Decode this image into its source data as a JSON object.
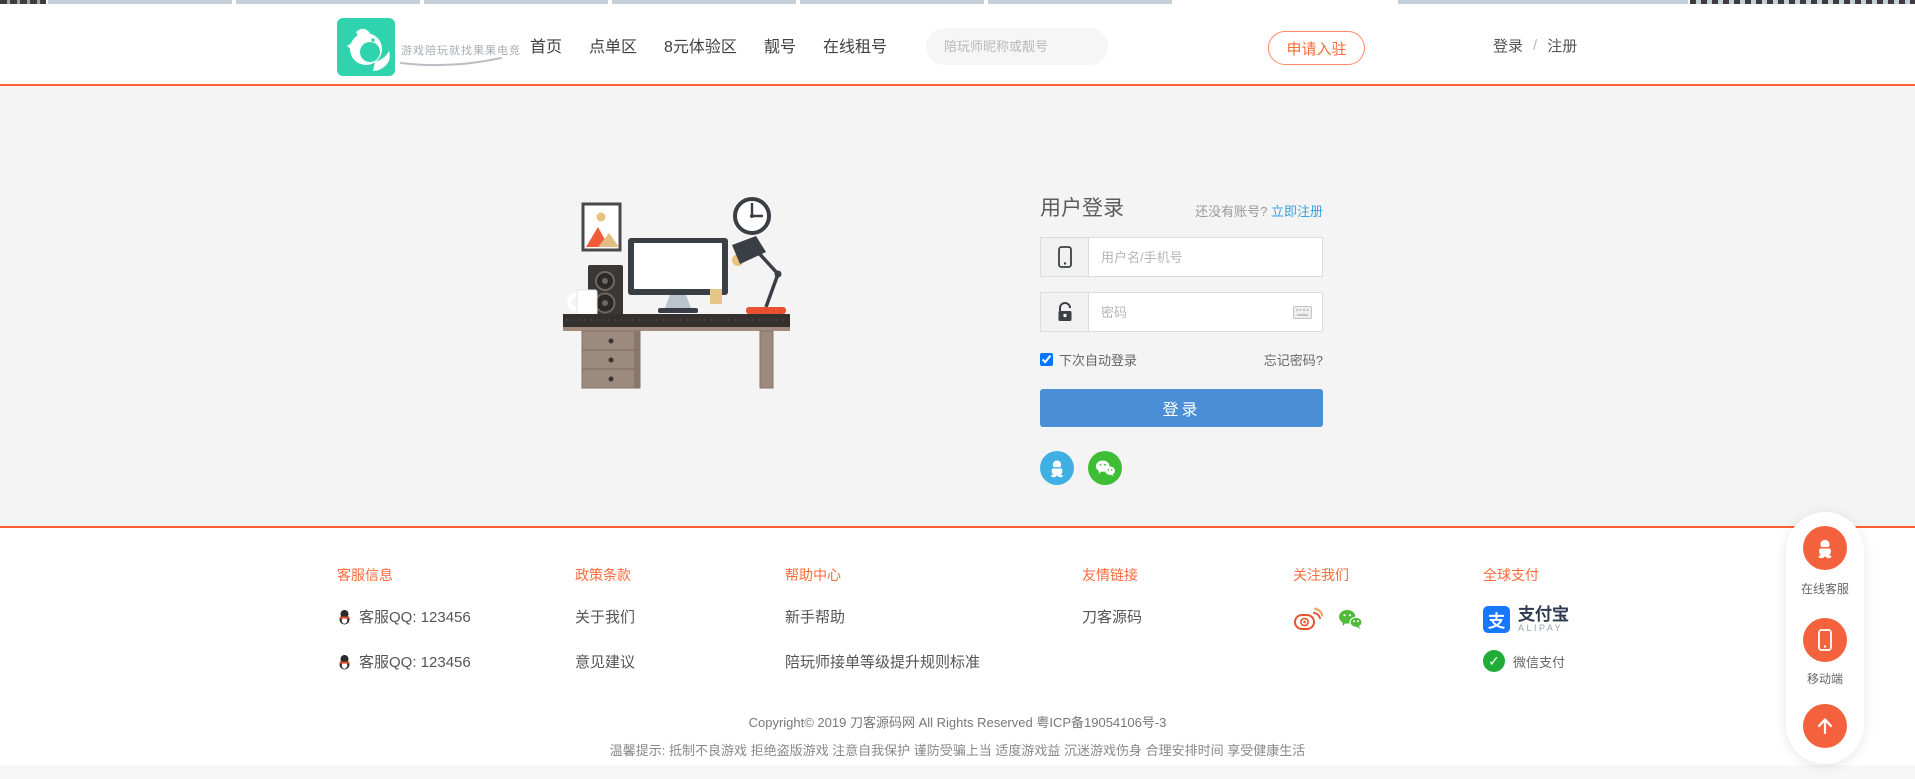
{
  "header": {
    "slogan": "游戏陪玩就找果果电竞",
    "nav": [
      "首页",
      "点单区",
      "8元体验区",
      "靓号",
      "在线租号"
    ],
    "search_placeholder": "陪玩师昵称或靓号",
    "apply_button": "申请入驻",
    "login": "登录",
    "separator": "/",
    "register": "注册"
  },
  "login_panel": {
    "title": "用户登录",
    "no_account": "还没有账号?",
    "register_now": "立即注册",
    "username_placeholder": "用户名/手机号",
    "password_placeholder": "密码",
    "remember": "下次自动登录",
    "forgot": "忘记密码?",
    "submit": "登录"
  },
  "footer": {
    "service": {
      "title": "客服信息",
      "items": [
        "客服QQ: 123456",
        "客服QQ: 123456"
      ]
    },
    "policy": {
      "title": "政策条款",
      "items": [
        "关于我们",
        "意见建议"
      ]
    },
    "help": {
      "title": "帮助中心",
      "items": [
        "新手帮助",
        "陪玩师接单等级提升规则标准"
      ]
    },
    "links": {
      "title": "友情链接",
      "items": [
        "刀客源码"
      ]
    },
    "follow": {
      "title": "关注我们"
    },
    "pay": {
      "title": "全球支付",
      "alipay_char": "支",
      "alipay": "支付宝",
      "alipay_en": "ALIPAY",
      "wechatpay_check": "✓",
      "wechatpay": "微信支付"
    },
    "copyright": "Copyright© 2019 刀客源码网 All Rights Reserved 粤ICP备19054106号-3",
    "tips": "温馨提示: 抵制不良游戏 拒绝盗版游戏 注意自我保护 谨防受骗上当 适度游戏益 沉迷游戏伤身 合理安排时间 享受健康生活"
  },
  "floatbar": {
    "service": "在线客服",
    "mobile": "移动端"
  },
  "colors": {
    "accent_orange": "#ff5f30",
    "brand_teal": "#2fd3ae",
    "link_blue": "#3aa4dc",
    "button_blue": "#4a8ed5",
    "qq_blue": "#3fb0e4",
    "wechat_green": "#3dbe34",
    "alipay_blue": "#1678ff",
    "wechatpay_green": "#21ac38",
    "float_orange": "#f4623d"
  }
}
